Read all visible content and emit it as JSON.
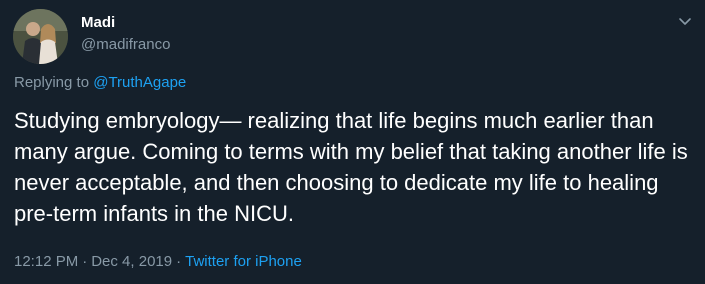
{
  "author": {
    "name": "Madi",
    "handle": "@madifranco"
  },
  "icons": {
    "avatar": "profile-photo",
    "menu": "chevron-down-icon"
  },
  "reply": {
    "prefix": "Replying to",
    "mention": "@TruthAgape"
  },
  "tweet": {
    "text": "Studying embryology— realizing that life begins much earlier than many argue. Coming to terms with my belief that taking another life is never acceptable, and then choosing to dedicate my life to healing pre-term infants in the NICU."
  },
  "meta": {
    "time": "12:12 PM",
    "date": "Dec 4, 2019",
    "separator": "·",
    "source": "Twitter for iPhone"
  },
  "colors": {
    "background": "#15202b",
    "text": "#ffffff",
    "secondary": "#8899a6",
    "link": "#1da1f2"
  }
}
